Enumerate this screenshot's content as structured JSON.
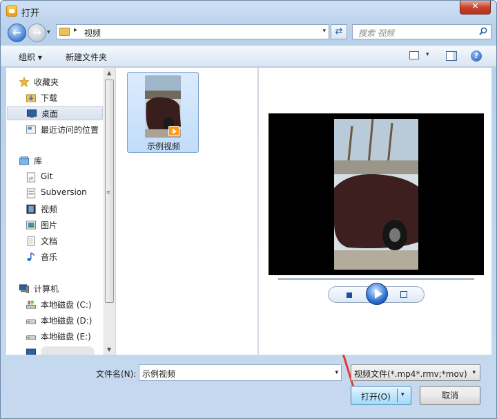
{
  "window": {
    "title": "打开",
    "close_label": "✕"
  },
  "nav": {
    "back_label": "←",
    "forward_label": "→",
    "dropdown": "▾"
  },
  "address": {
    "separator": "▸",
    "path": "视频",
    "dropdown": "▾"
  },
  "refresh_label": "⇄",
  "search": {
    "placeholder": "搜索 视频"
  },
  "toolbar": {
    "organize_label": "组织 ▾",
    "new_folder_label": "新建文件夹",
    "view_dropdown": "▾",
    "help_label": "?"
  },
  "sidebar": {
    "favorites_header": "收藏夹",
    "favorites": [
      "下载",
      "桌面",
      "最近访问的位置"
    ],
    "libraries_header": "库",
    "libraries": [
      "Git",
      "Subversion",
      "视频",
      "图片",
      "文档",
      "音乐"
    ],
    "computer_header": "计算机",
    "drives": [
      "本地磁盘 (C:)",
      "本地磁盘 (D:)",
      "本地磁盘 (E:)"
    ],
    "selected": "桌面"
  },
  "scrollbar": {
    "up": "▲",
    "down": "▼",
    "grip": "≡"
  },
  "files": [
    {
      "name": "示例视频",
      "icon": "video-file-icon"
    }
  ],
  "bottom": {
    "filename_label": "文件名(N):",
    "filename_value": "示例视频",
    "filetype_value": "视频文件(*.mp4*.rmv;*mov)",
    "open_label": "打开(O)",
    "cancel_label": "取消",
    "dropdown": "▾"
  },
  "colors": {
    "accent": "#3c7fb1",
    "selection": "#c1dcfa",
    "annotation_arrow": "#e8382b"
  }
}
